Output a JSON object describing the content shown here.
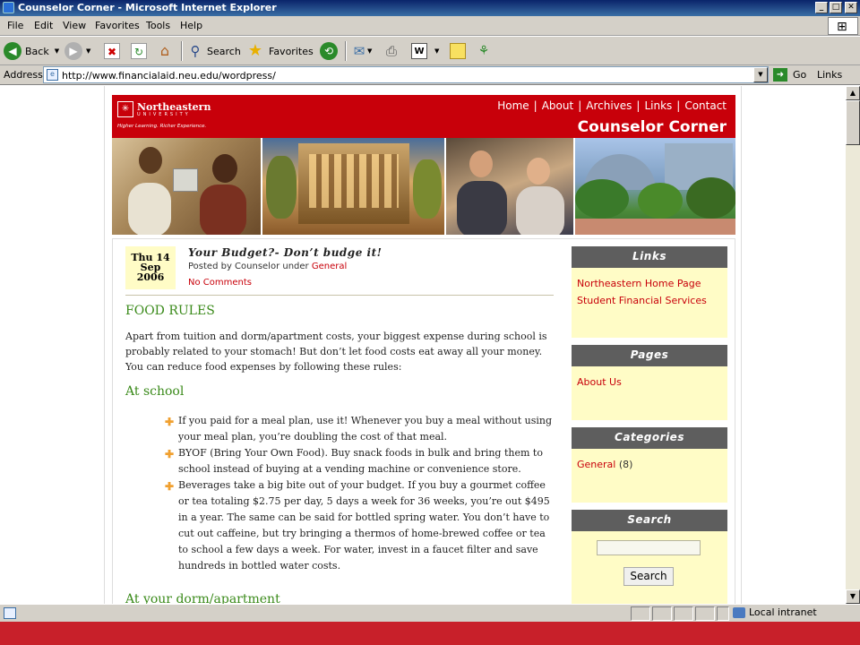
{
  "window": {
    "title": "Counselor Corner - Microsoft Internet Explorer",
    "minimize": "_",
    "maximize": "□",
    "close": "✕"
  },
  "menu": [
    "File",
    "Edit",
    "View",
    "Favorites",
    "Tools",
    "Help"
  ],
  "toolbar": {
    "back": "Back",
    "search": "Search",
    "favorites": "Favorites"
  },
  "address": {
    "label": "Address",
    "url": "http://www.financialaid.neu.edu/wordpress/",
    "go": "Go",
    "links": "Links"
  },
  "site": {
    "logo_name": "Northeastern",
    "logo_univ": "UNIVERSITY",
    "logo_tag": "Higher Learning. Richer Experience.",
    "title": "Counselor Corner",
    "nav": [
      "Home",
      "About",
      "Archives",
      "Links",
      "Contact"
    ]
  },
  "post": {
    "date_line1": "Thu 14",
    "date_line2": "Sep",
    "date_line3": "2006",
    "title": "Your Budget?- Don’t budge it!",
    "posted_by": "Posted by Counselor under ",
    "category": "General",
    "comments": "No Comments",
    "heading1": "FOOD RULES",
    "intro": "Apart from tuition and dorm/apartment costs, your biggest expense during school is probably related to your stomach! But don’t let food costs eat away all your money. You can reduce food expenses by following these rules:",
    "heading2": "At school",
    "bullets": [
      "If you paid for a meal plan, use it! Whenever you buy a meal without using your meal plan, you’re doubling the cost of that meal.",
      "BYOF (Bring Your Own Food). Buy snack foods in bulk and bring them to school instead of buying at a vending machine or convenience store.",
      "Beverages take a big bite out of your budget. If you buy a gourmet coffee or tea totaling $2.75 per day, 5 days a week for 36 weeks, you’re out $495 in a year. The same can be said for bottled spring water. You don’t have to cut out caffeine, but try bringing a thermos of home-brewed coffee or tea to school a few days a week. For water, invest in a faucet filter and save hundreds in bottled water costs."
    ],
    "heading3": "At your dorm/apartment"
  },
  "sidebar": {
    "links_title": "Links",
    "links": [
      "Northeastern Home Page",
      "Student Financial Services"
    ],
    "pages_title": "Pages",
    "pages": [
      "About Us"
    ],
    "categories_title": "Categories",
    "category_name": "General",
    "category_count": " (8)",
    "search_title": "Search",
    "search_button": "Search"
  },
  "status": {
    "zone": "Local intranet"
  }
}
